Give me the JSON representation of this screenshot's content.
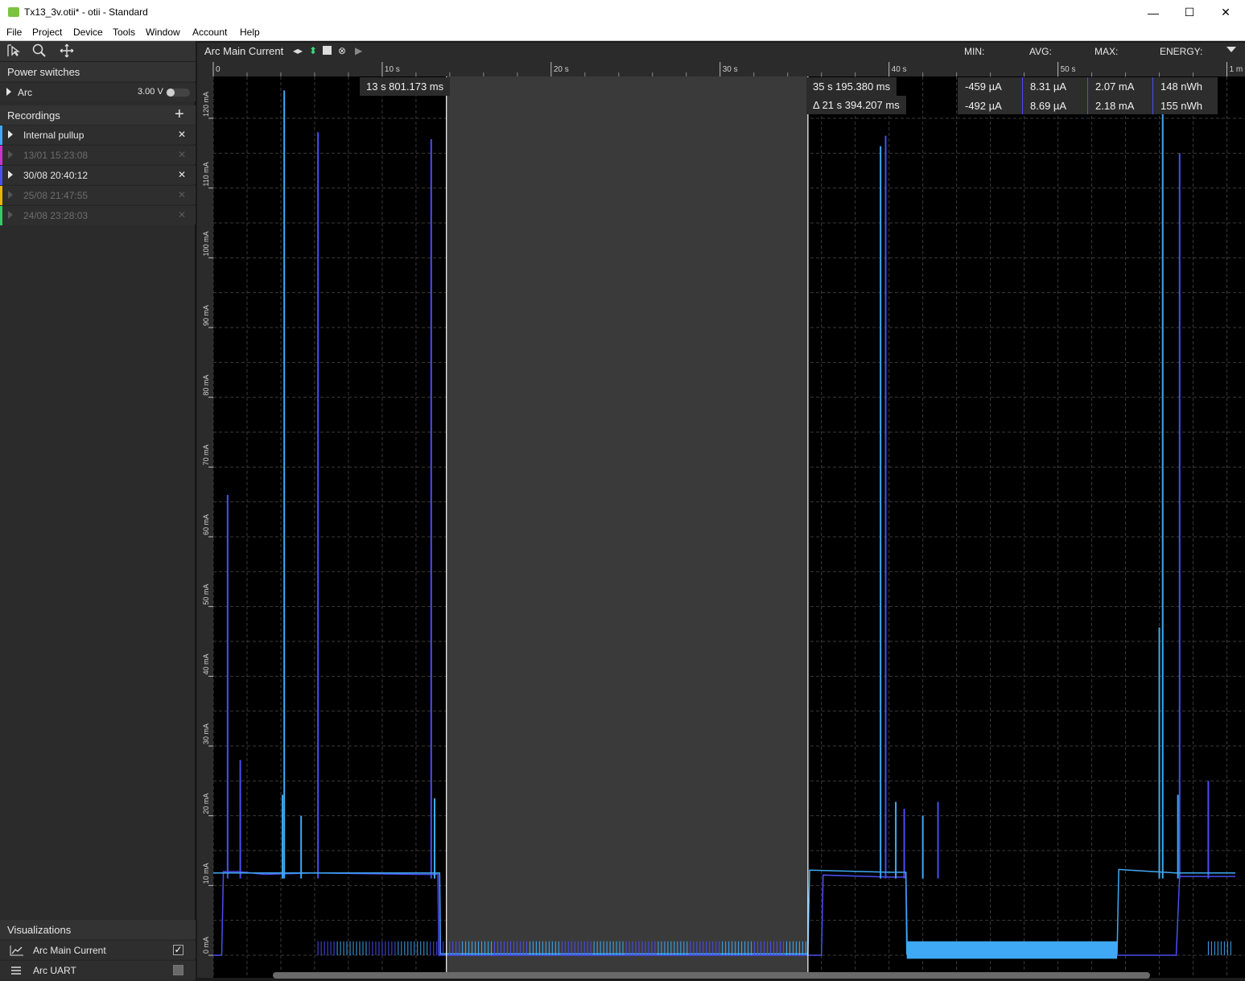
{
  "window": {
    "title": "Tx13_3v.otii* - otii - Standard",
    "minimize_glyph": "—",
    "maximize_glyph": "☐",
    "close_glyph": "✕"
  },
  "menu": [
    "File",
    "Project",
    "Device",
    "Tools",
    "Window",
    "Account",
    "Help"
  ],
  "sidebar": {
    "power_switches_title": "Power switches",
    "device_name": "Arc",
    "device_voltage": "3.00 V",
    "recordings_title": "Recordings",
    "add_glyph": "+",
    "recordings": [
      {
        "label": "Internal pullup",
        "active": true,
        "color": "#3fa9f5"
      },
      {
        "label": "13/01 15:23:08",
        "active": false,
        "color": "#cc33cc"
      },
      {
        "label": "30/08 20:40:12",
        "active": true,
        "color": "#4b4ef0"
      },
      {
        "label": "25/08 21:47:55",
        "active": false,
        "color": "#e6b800"
      },
      {
        "label": "24/08 23:28:03",
        "active": false,
        "color": "#33cc66"
      }
    ],
    "close_glyph": "✕",
    "visualizations_title": "Visualizations",
    "visualizations": [
      {
        "label": "Arc Main Current",
        "checked": true
      },
      {
        "label": "Arc UART",
        "checked": false
      }
    ]
  },
  "plot": {
    "title": "Arc Main Current",
    "stats_headers": [
      "MIN:",
      "AVG:",
      "MAX:",
      "ENERGY:"
    ],
    "stats_rows": [
      [
        "-459 µA",
        "8.31 µA",
        "2.07 mA",
        "148 nWh"
      ],
      [
        "-492 µA",
        "8.69 µA",
        "2.18 mA",
        "155 nWh"
      ]
    ],
    "cursor_left": "13 s 801.173 ms",
    "cursor_right": "35 s 195.380 ms",
    "cursor_delta": "Δ 21 s 394.207 ms"
  },
  "chart_data": {
    "type": "line",
    "xlim": [
      0,
      60.5
    ],
    "ylim": [
      -1.5,
      126
    ],
    "x_tick_values": [
      0,
      10,
      20,
      30,
      40,
      50,
      60
    ],
    "x_tick_labels": [
      "0",
      "10 s",
      "20 s",
      "30 s",
      "40 s",
      "50 s",
      "1 m"
    ],
    "y_tick_values": [
      0,
      10,
      20,
      30,
      40,
      50,
      60,
      70,
      80,
      90,
      100,
      110,
      120
    ],
    "y_tick_labels": [
      "0 mA",
      "10 mA",
      "20 mA",
      "30 mA",
      "40 mA",
      "50 mA",
      "60 mA",
      "70 mA",
      "80 mA",
      "90 mA",
      "100 mA",
      "110 mA",
      "120 mA"
    ],
    "selection_x": [
      13.8,
      35.2
    ],
    "series": [
      {
        "color": "#4b4ef0",
        "baseline": [
          [
            0,
            0
          ],
          [
            0.5,
            0
          ],
          [
            0.6,
            12
          ],
          [
            1.5,
            12
          ],
          [
            3,
            11.6
          ],
          [
            6,
            11.8
          ],
          [
            12,
            11.6
          ],
          [
            13.3,
            11.6
          ],
          [
            13.35,
            0
          ],
          [
            36,
            0
          ],
          [
            36.1,
            11.5
          ],
          [
            40,
            11.2
          ],
          [
            41,
            11.2
          ],
          [
            41.1,
            0
          ],
          [
            57,
            0
          ],
          [
            57.2,
            11.3
          ],
          [
            60.5,
            11.3
          ]
        ],
        "spikes": [
          [
            0.85,
            66
          ],
          [
            1.6,
            28
          ],
          [
            6.2,
            118
          ],
          [
            12.9,
            117
          ],
          [
            39.8,
            117.5
          ],
          [
            40.9,
            21
          ],
          [
            42.9,
            22
          ],
          [
            57.2,
            115
          ],
          [
            58.9,
            25
          ]
        ]
      },
      {
        "color": "#3fa9f5",
        "baseline": [
          [
            0,
            11.8
          ],
          [
            13.4,
            11.8
          ],
          [
            13.45,
            0.2
          ],
          [
            35.2,
            0.2
          ],
          [
            35.3,
            12.2
          ],
          [
            40,
            11.9
          ],
          [
            41,
            11.9
          ],
          [
            41.05,
            0.2
          ],
          [
            53.5,
            0.2
          ],
          [
            53.6,
            12.3
          ],
          [
            57,
            11.8
          ],
          [
            60.5,
            11.8
          ]
        ],
        "spikes": [
          [
            4.2,
            124
          ],
          [
            4.1,
            23
          ],
          [
            5.2,
            20
          ],
          [
            13.1,
            22.5
          ],
          [
            39.5,
            116
          ],
          [
            40.4,
            22
          ],
          [
            42.0,
            20
          ],
          [
            56.2,
            125
          ],
          [
            56.0,
            47
          ],
          [
            57.1,
            23
          ]
        ]
      }
    ]
  }
}
